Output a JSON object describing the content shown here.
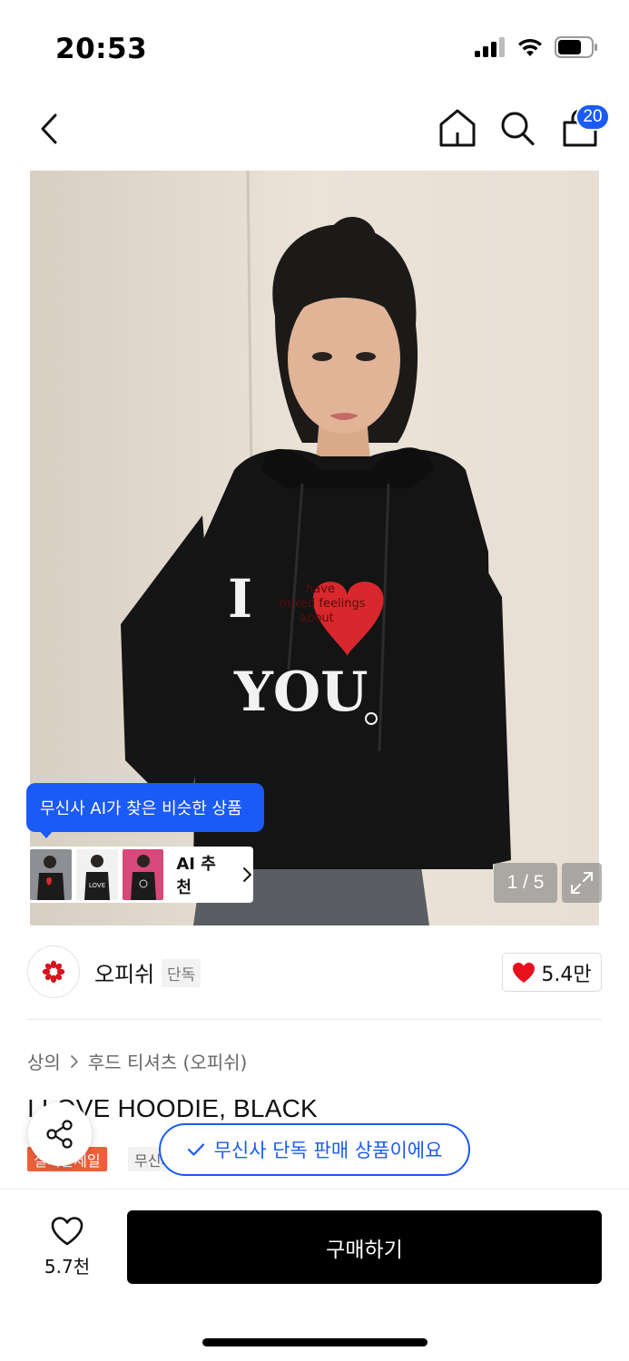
{
  "status_bar": {
    "time": "20:53"
  },
  "nav": {
    "cart_count": "20"
  },
  "product_image": {
    "ai_bubble_text": "무신사 AI가 찾은 비슷한 상품",
    "ai_recommend_label": "AI 추천",
    "page_counter": "1 / 5",
    "print_text": {
      "have": "have",
      "mixed": "mixed feelings",
      "about": "about",
      "i": "I",
      "you": "YOU"
    },
    "thumbnail_text": "LOVE"
  },
  "brand": {
    "name": "오피쉬",
    "tag": "단독",
    "likes": "5.4만"
  },
  "breadcrumb": {
    "category": "상의",
    "subcategory": "후드 티셔츠 (오피쉬)"
  },
  "product": {
    "title": "I LOVE HOODIE, BLACK"
  },
  "badges": {
    "sale": "실시간세일",
    "exclusive": "무신사 단독"
  },
  "toast": {
    "text": "무신사 단독 판매 상품이에요"
  },
  "bottom_bar": {
    "wish_count": "5.7천",
    "buy_label": "구매하기"
  },
  "colors": {
    "accent": "#1a5af7",
    "sale": "#f15f3a",
    "heart": "#e8101e"
  }
}
